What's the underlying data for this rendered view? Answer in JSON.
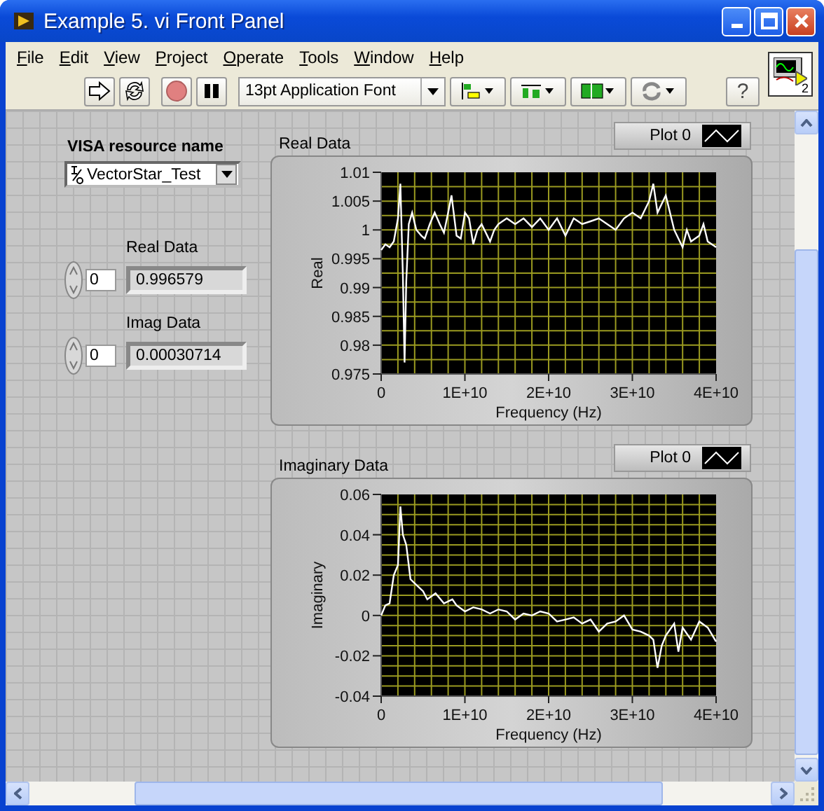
{
  "window": {
    "title": "Example 5. vi Front Panel"
  },
  "menu": [
    "File",
    "Edit",
    "View",
    "Project",
    "Operate",
    "Tools",
    "Window",
    "Help"
  ],
  "toolbar": {
    "font": "13pt Application Font",
    "help": "?"
  },
  "vi_icon": {
    "badge": "2"
  },
  "visa": {
    "label": "VISA resource name",
    "value": "VectorStar_Test"
  },
  "indicators": [
    {
      "label": "Real Data",
      "index": "0",
      "value": "0.996579"
    },
    {
      "label": "Imag Data",
      "index": "0",
      "value": "0.00030714"
    }
  ],
  "graphs": [
    {
      "title": "Real Data",
      "chart_data": {
        "type": "line",
        "grid": true,
        "xlabel": "Frequency (Hz)",
        "ylabel": "Real",
        "xlim": [
          0,
          40000000000.0
        ],
        "ylim": [
          0.975,
          1.01
        ],
        "x": [
          0,
          500000000.0,
          1000000000.0,
          1500000000.0,
          2000000000.0,
          2300000000.0,
          2600000000.0,
          2800000000.0,
          3000000000.0,
          3300000000.0,
          3700000000.0,
          4200000000.0,
          4800000000.0,
          5200000000.0,
          5800000000.0,
          6400000000.0,
          7000000000.0,
          7500000000.0,
          8000000000.0,
          8400000000.0,
          9000000000.0,
          9500000000.0,
          10000000000.0,
          10500000000.0,
          11000000000.0,
          11500000000.0,
          12000000000.0,
          13000000000.0,
          13500000000.0,
          14000000000.0,
          15000000000.0,
          16000000000.0,
          17000000000.0,
          18000000000.0,
          19000000000.0,
          20000000000.0,
          21000000000.0,
          22000000000.0,
          23000000000.0,
          24000000000.0,
          25000000000.0,
          26000000000.0,
          27000000000.0,
          28000000000.0,
          29000000000.0,
          30000000000.0,
          31000000000.0,
          32000000000.0,
          32500000000.0,
          33000000000.0,
          34000000000.0,
          35000000000.0,
          36000000000.0,
          36500000000.0,
          37000000000.0,
          38000000000.0,
          38500000000.0,
          39000000000.0,
          40000000000.0
        ],
        "series": [
          {
            "name": "Plot 0",
            "color": "#ffffff",
            "values": [
              0.9965,
              0.9975,
              0.997,
              0.998,
              1.002,
              1.008,
              0.992,
              0.977,
              0.991,
              1.001,
              1.003,
              1.0,
              0.999,
              0.9985,
              1.001,
              1.003,
              1.001,
              0.9995,
              1.003,
              1.006,
              0.999,
              0.9985,
              1.003,
              1.002,
              0.9975,
              1.0,
              1.001,
              0.998,
              1.0,
              1.001,
              1.002,
              1.001,
              1.002,
              1.0005,
              1.002,
              1.0,
              1.002,
              0.999,
              1.002,
              1.001,
              1.0015,
              1.002,
              1.001,
              1.0,
              1.002,
              1.003,
              1.002,
              1.005,
              1.008,
              1.003,
              1.006,
              1.0,
              0.997,
              1.0,
              0.998,
              0.999,
              1.001,
              0.998,
              0.997
            ]
          }
        ],
        "xticks": [
          {
            "value": 0,
            "label": "0"
          },
          {
            "value": 10000000000.0,
            "label": "1E+10"
          },
          {
            "value": 20000000000.0,
            "label": "2E+10"
          },
          {
            "value": 30000000000.0,
            "label": "3E+10"
          },
          {
            "value": 40000000000.0,
            "label": "4E+10"
          }
        ],
        "yticks": [
          1.01,
          1.005,
          1,
          0.995,
          0.99,
          0.985,
          0.98,
          0.975
        ]
      }
    },
    {
      "title": "Imaginary Data",
      "chart_data": {
        "type": "line",
        "grid": true,
        "xlabel": "Frequency (Hz)",
        "ylabel": "Imaginary",
        "xlim": [
          0,
          40000000000.0
        ],
        "ylim": [
          -0.04,
          0.06
        ],
        "x": [
          0,
          500000000.0,
          1000000000.0,
          1500000000.0,
          2000000000.0,
          2300000000.0,
          2600000000.0,
          3000000000.0,
          3500000000.0,
          4000000000.0,
          5000000000.0,
          5500000000.0,
          6500000000.0,
          7500000000.0,
          8500000000.0,
          9000000000.0,
          10000000000.0,
          11000000000.0,
          12000000000.0,
          13000000000.0,
          14000000000.0,
          15000000000.0,
          16000000000.0,
          17000000000.0,
          18000000000.0,
          19000000000.0,
          20000000000.0,
          21000000000.0,
          22000000000.0,
          23000000000.0,
          24000000000.0,
          25000000000.0,
          26000000000.0,
          27000000000.0,
          28000000000.0,
          29000000000.0,
          30000000000.0,
          31000000000.0,
          32000000000.0,
          32500000000.0,
          33000000000.0,
          33500000000.0,
          34000000000.0,
          35000000000.0,
          35500000000.0,
          36000000000.0,
          37000000000.0,
          38000000000.0,
          39000000000.0,
          40000000000.0
        ],
        "series": [
          {
            "name": "Plot 0",
            "color": "#ffffff",
            "values": [
              0,
              0.005,
              0.006,
              0.02,
              0.025,
              0.054,
              0.04,
              0.035,
              0.018,
              0.016,
              0.012,
              0.008,
              0.011,
              0.006,
              0.008,
              0.005,
              0.002,
              0.004,
              0.003,
              0.001,
              0.003,
              0.002,
              -0.002,
              0.001,
              0,
              0.002,
              0.001,
              -0.003,
              -0.002,
              -0.001,
              -0.004,
              -0.002,
              -0.008,
              -0.004,
              -0.003,
              0,
              -0.007,
              -0.008,
              -0.01,
              -0.012,
              -0.026,
              -0.015,
              -0.01,
              -0.004,
              -0.018,
              -0.006,
              -0.012,
              -0.003,
              -0.006,
              -0.013
            ]
          }
        ],
        "xticks": [
          {
            "value": 0,
            "label": "0"
          },
          {
            "value": 10000000000.0,
            "label": "1E+10"
          },
          {
            "value": 20000000000.0,
            "label": "2E+10"
          },
          {
            "value": 30000000000.0,
            "label": "3E+10"
          },
          {
            "value": 40000000000.0,
            "label": "4E+10"
          }
        ],
        "yticks": [
          0.06,
          0.04,
          0.02,
          0,
          -0.02,
          -0.04
        ]
      }
    }
  ]
}
